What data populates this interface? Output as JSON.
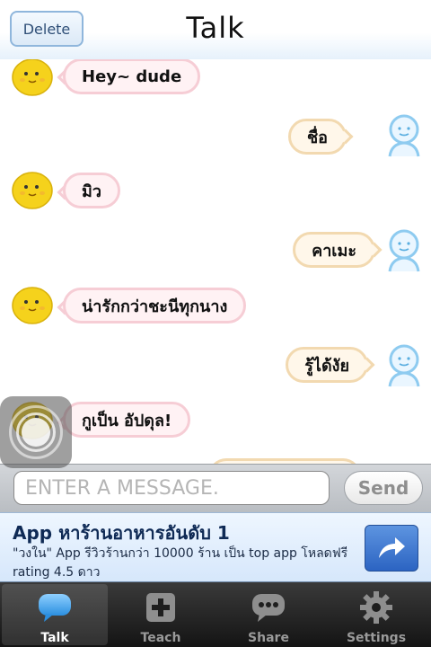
{
  "header": {
    "title": "Talk",
    "delete_label": "Delete"
  },
  "messages": [
    {
      "sender": "bot",
      "text": "Hey~ dude"
    },
    {
      "sender": "user",
      "text": "ชื่อ"
    },
    {
      "sender": "bot",
      "text": "มิว"
    },
    {
      "sender": "user",
      "text": "คาเมะ"
    },
    {
      "sender": "bot",
      "text": "น่ารักกว่าชะนีทุกนาง"
    },
    {
      "sender": "user",
      "text": "รู้ได้งัย"
    },
    {
      "sender": "bot",
      "text": "กูเป็น อัปดุล!"
    }
  ],
  "composer": {
    "placeholder": "ENTER A MESSAGE.",
    "send_label": "Send"
  },
  "ad": {
    "title": "App หาร้านอาหารอันดับ 1",
    "line1": "\"วงใน\" App รีวิวร้านกว่า 10000 ร้าน เป็น top app โหลดฟรี",
    "line2": "rating 4.5 ดาว"
  },
  "tabs": [
    {
      "label": "Talk",
      "icon": "speech-bubble-icon",
      "active": true
    },
    {
      "label": "Teach",
      "icon": "plus-icon",
      "active": false
    },
    {
      "label": "Share",
      "icon": "chat-dots-icon",
      "active": false
    },
    {
      "label": "Settings",
      "icon": "gear-icon",
      "active": false
    }
  ],
  "colors": {
    "accent": "#4aa3e8",
    "bot_bubble_border": "#f6cdd5",
    "user_bubble_border": "#f2d9b0",
    "tabbar_bg": "#1e1e1e"
  }
}
